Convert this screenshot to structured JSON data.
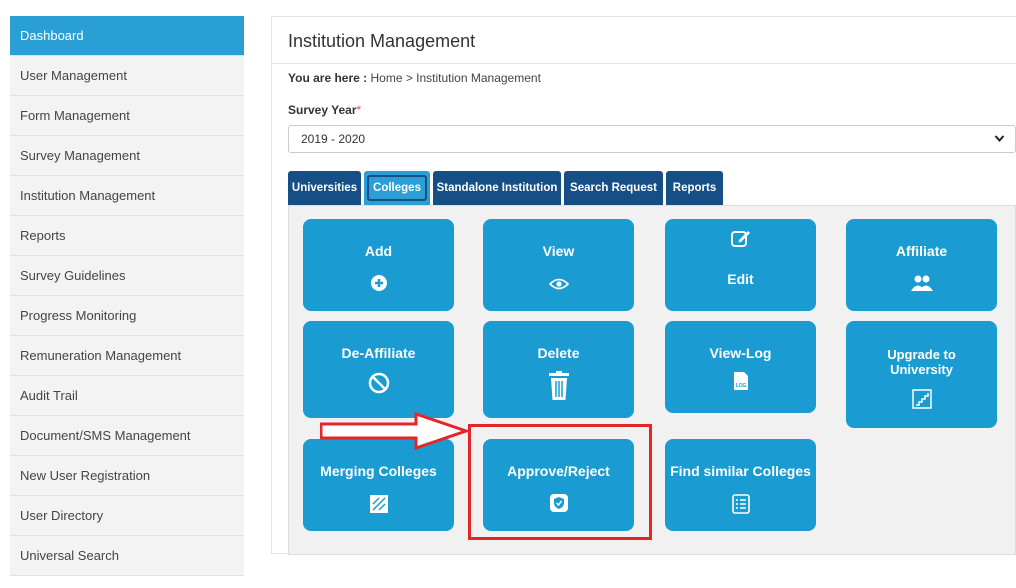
{
  "sidebar": {
    "items": [
      {
        "label": "Dashboard"
      },
      {
        "label": "User Management"
      },
      {
        "label": "Form Management"
      },
      {
        "label": "Survey Management"
      },
      {
        "label": "Institution Management"
      },
      {
        "label": "Reports"
      },
      {
        "label": "Survey Guidelines"
      },
      {
        "label": "Progress Monitoring"
      },
      {
        "label": "Remuneration Management"
      },
      {
        "label": "Audit Trail"
      },
      {
        "label": "Document/SMS Management"
      },
      {
        "label": "New User Registration"
      },
      {
        "label": "User Directory"
      },
      {
        "label": "Universal Search"
      }
    ],
    "active": "Dashboard"
  },
  "main": {
    "title": "Institution Management",
    "breadcrumb_prefix": "You are here :",
    "breadcrumb_trail": "Home > Institution Management",
    "survey_year_label": "Survey Year",
    "required_mark": "*",
    "survey_year_value": "2019 - 2020",
    "tabs": [
      {
        "label": "Universities"
      },
      {
        "label": "Colleges"
      },
      {
        "label": "Standalone Institution"
      },
      {
        "label": "Search Request"
      },
      {
        "label": "Reports"
      }
    ],
    "active_tab": "Colleges",
    "tiles": [
      {
        "label": "Add",
        "icon": "plus-circle-icon"
      },
      {
        "label": "View",
        "icon": "eye-icon"
      },
      {
        "label": "Edit",
        "icon": "edit-icon"
      },
      {
        "label": "Affiliate",
        "icon": "users-icon"
      },
      {
        "label": "De-Affiliate",
        "icon": "ban-icon"
      },
      {
        "label": "Delete",
        "icon": "trash-icon"
      },
      {
        "label": "View-Log",
        "icon": "log-file-icon"
      },
      {
        "label": "Upgrade to University",
        "icon": "stairs-icon"
      },
      {
        "label": "Merging Colleges",
        "icon": "merge-icon"
      },
      {
        "label": "Approve/Reject",
        "icon": "shield-check-icon"
      },
      {
        "label": "Find similar Colleges",
        "icon": "list-icon"
      }
    ]
  },
  "colors": {
    "accent": "#1a9bd1",
    "tab_dark": "#164e86",
    "highlight": "#e4262b",
    "sidebar_active": "#2a9fd6"
  }
}
